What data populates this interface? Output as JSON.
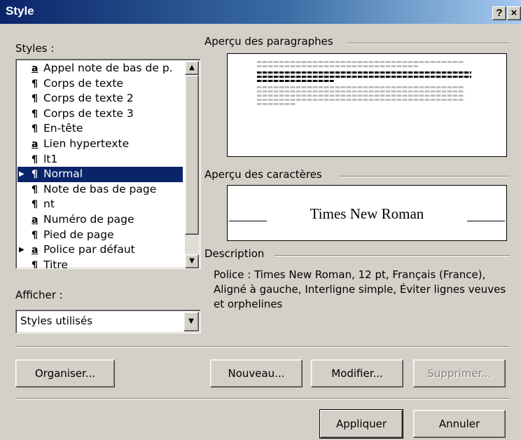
{
  "dialog": {
    "title": "Style",
    "help_button": "?",
    "close_button": "×"
  },
  "styles_panel": {
    "label": "Styles :",
    "items": [
      {
        "type": "a",
        "label": "Appel note de bas de p.",
        "selected": false,
        "marker": false
      },
      {
        "type": "¶",
        "label": "Corps de texte",
        "selected": false,
        "marker": false
      },
      {
        "type": "¶",
        "label": "Corps de texte 2",
        "selected": false,
        "marker": false
      },
      {
        "type": "¶",
        "label": "Corps de texte 3",
        "selected": false,
        "marker": false
      },
      {
        "type": "¶",
        "label": "En-tête",
        "selected": false,
        "marker": false
      },
      {
        "type": "a",
        "label": "Lien hypertexte",
        "selected": false,
        "marker": false
      },
      {
        "type": "¶",
        "label": "lt1",
        "selected": false,
        "marker": false
      },
      {
        "type": "¶",
        "label": "Normal",
        "selected": true,
        "marker": true
      },
      {
        "type": "¶",
        "label": "Note de bas de page",
        "selected": false,
        "marker": false
      },
      {
        "type": "¶",
        "label": "nt",
        "selected": false,
        "marker": false
      },
      {
        "type": "a",
        "label": "Numéro de page",
        "selected": false,
        "marker": false
      },
      {
        "type": "¶",
        "label": "Pied de page",
        "selected": false,
        "marker": false
      },
      {
        "type": "a",
        "label": "Police par défaut",
        "selected": false,
        "marker": true
      },
      {
        "type": "¶",
        "label": "Titre",
        "selected": false,
        "marker": false
      }
    ]
  },
  "show_panel": {
    "label": "Afficher :",
    "selected_value": "Styles utilisés"
  },
  "paragraph_preview": {
    "label": "Aperçu des paragraphes"
  },
  "character_preview": {
    "label": "Aperçu des caractères",
    "font_sample": "Times New Roman"
  },
  "description": {
    "label": "Description",
    "text": "Police : Times New Roman, 12 pt, Français (France), Aligné à gauche, Interligne simple, Éviter lignes veuves et orphelines"
  },
  "buttons": {
    "organize": "Organiser...",
    "new": "Nouveau...",
    "modify": "Modifier...",
    "delete": "Supprimer...",
    "apply": "Appliquer",
    "cancel": "Annuler"
  }
}
